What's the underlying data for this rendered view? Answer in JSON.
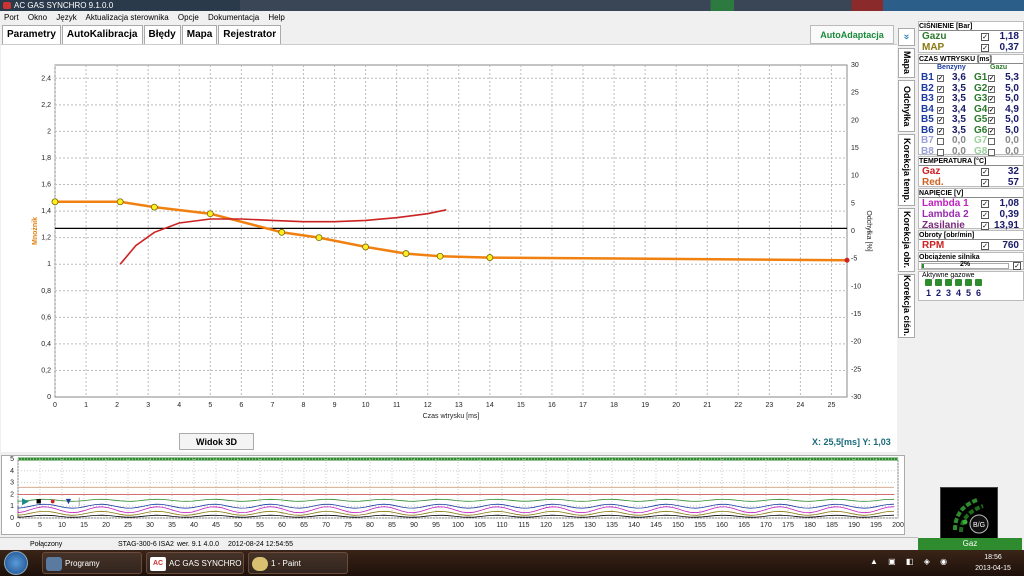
{
  "window": {
    "title": "AC GAS SYNCHRO 9.1.0.0"
  },
  "menu": [
    "Port",
    "Okno",
    "Język",
    "Aktualizacja sterownika",
    "Opcje",
    "Dokumentacja",
    "Help"
  ],
  "tabs": [
    "Parametry",
    "AutoKalibracja",
    "Błędy",
    "Mapa",
    "Rejestrator"
  ],
  "autoadapt_label": "AutoAdaptacja",
  "vertical_tabs": [
    "Mapa",
    "Odchyłka",
    "Korekcja temp.",
    "Korekcja obr.",
    "Korekcja ciśn."
  ],
  "vtab_icon": "scroll-icon",
  "right": {
    "pressure": {
      "title": "CIŚNIENIE [Bar]",
      "gaz_label": "Gazu",
      "gaz_value": "1,18",
      "map_label": "MAP",
      "map_value": "0,37"
    },
    "injection": {
      "title": "CZAS WTRYSKU [ms]",
      "benz_header": "Benzyny",
      "gaz_header": "Gazu",
      "rows": [
        {
          "b": "B1",
          "bv": "3,6",
          "g": "G1",
          "gv": "5,3"
        },
        {
          "b": "B2",
          "bv": "3,5",
          "g": "G2",
          "gv": "5,0"
        },
        {
          "b": "B3",
          "bv": "3,5",
          "g": "G3",
          "gv": "5,0"
        },
        {
          "b": "B4",
          "bv": "3,4",
          "g": "G4",
          "gv": "4,9"
        },
        {
          "b": "B5",
          "bv": "3,5",
          "g": "G5",
          "gv": "5,0"
        },
        {
          "b": "B6",
          "bv": "3,5",
          "g": "G6",
          "gv": "5,0"
        },
        {
          "b": "B7",
          "bv": "0,0",
          "g": "G7",
          "gv": "0,0"
        },
        {
          "b": "B8",
          "bv": "0,0",
          "g": "G8",
          "gv": "0,0"
        }
      ]
    },
    "temperature": {
      "title": "TEMPERATURA [°C]",
      "gaz_label": "Gaz",
      "gaz_value": "32",
      "red_label": "Red.",
      "red_value": "57"
    },
    "voltage": {
      "title": "NAPIĘCIE [V]",
      "l1_label": "Lambda 1",
      "l1_value": "1,08",
      "l2_label": "Lambda 2",
      "l2_value": "0,39",
      "zas_label": "Zasilanie",
      "zas_value": "13,91"
    },
    "rpm": {
      "title": "Obroty [obr/min]",
      "label": "RPM",
      "value": "760"
    },
    "load": {
      "title": "Obciążenie silnika",
      "value": "2%",
      "fraction": 0.02
    },
    "active": {
      "title": "Aktywne gazowe",
      "items": [
        "1",
        "2",
        "3",
        "4",
        "5",
        "6"
      ]
    }
  },
  "widok_label": "Widok 3D",
  "coords": {
    "x_label": "X:",
    "x_value": "25,5[ms]",
    "y_label": "Y:",
    "y_value": "1,03"
  },
  "gas_panel_label": "B/G",
  "gas_mode": "Gaz",
  "status": {
    "connection": "Połączony",
    "device": "STAG-300-6 ISA2",
    "version": "wer. 9.1 4.0.0",
    "date": "2012-08-24 12:54:55"
  },
  "taskbar": {
    "programs": "Programy",
    "app1": "AC GAS SYNCHRO",
    "app2": "1 - Paint",
    "time": "18:56",
    "date": "2013-04-15"
  },
  "colors": {
    "orange": "#f08010",
    "red": "#cc2222",
    "green": "#1a8a3a",
    "gaz": "#2a7a2a",
    "map": "#8a7a10",
    "lambda": "#c020c0",
    "zasilanie": "#7a2a7a",
    "temp_red": "#d06020"
  },
  "chart_data": {
    "type": "line",
    "xlabel": "Czas wtrysku [ms]",
    "ylabel": "Mnożnik",
    "y2label": "Odchyłka [%]",
    "xlim": [
      0,
      25.5
    ],
    "ylim": [
      0,
      2.5
    ],
    "y2lim": [
      -30,
      30
    ],
    "xticks": [
      0,
      1,
      2,
      3,
      4,
      5,
      6,
      7,
      8,
      9,
      10,
      11,
      12,
      13,
      14,
      15,
      16,
      17,
      18,
      19,
      20,
      21,
      22,
      23,
      24,
      25
    ],
    "yticks": [
      "0",
      "0,2",
      "0,4",
      "0,6",
      "0,8",
      "1",
      "1,2",
      "1,4",
      "1,6",
      "1,8",
      "2",
      "2,2",
      "2,4"
    ],
    "y2ticks": [
      "-30",
      "-25",
      "-20",
      "-15",
      "-10",
      "-5",
      "0",
      "5",
      "10",
      "15",
      "20",
      "25",
      "30"
    ],
    "reference_line": 1.27,
    "series": [
      {
        "color": "#f08010",
        "points": [
          [
            0,
            1.47
          ],
          [
            2.1,
            1.47
          ],
          [
            3.2,
            1.43
          ],
          [
            5,
            1.38
          ],
          [
            7.3,
            1.24
          ],
          [
            8.5,
            1.2
          ],
          [
            10,
            1.13
          ],
          [
            11.3,
            1.08
          ],
          [
            12.4,
            1.06
          ],
          [
            14,
            1.05
          ],
          [
            25.5,
            1.03
          ]
        ],
        "markers": [
          [
            0,
            1.47
          ],
          [
            2.1,
            1.47
          ],
          [
            3.2,
            1.43
          ],
          [
            5,
            1.38
          ],
          [
            7.3,
            1.24
          ],
          [
            8.5,
            1.2
          ],
          [
            10,
            1.13
          ],
          [
            11.3,
            1.08
          ],
          [
            12.4,
            1.06
          ],
          [
            14,
            1.05
          ]
        ]
      },
      {
        "color": "#cc2222",
        "points": [
          [
            2.1,
            1.0
          ],
          [
            2.6,
            1.14
          ],
          [
            3.2,
            1.24
          ],
          [
            4,
            1.31
          ],
          [
            5,
            1.34
          ],
          [
            6,
            1.34
          ],
          [
            7,
            1.33
          ],
          [
            8,
            1.32
          ],
          [
            9,
            1.32
          ],
          [
            10,
            1.33
          ],
          [
            11,
            1.35
          ],
          [
            12,
            1.38
          ],
          [
            12.6,
            1.41
          ]
        ]
      }
    ]
  },
  "lower_chart": {
    "xticks": [
      "0",
      "5",
      "10",
      "15",
      "20",
      "25",
      "30",
      "35",
      "40",
      "45",
      "50",
      "55",
      "60",
      "65",
      "70",
      "75",
      "80",
      "85",
      "90",
      "95",
      "100",
      "105",
      "110",
      "115",
      "120",
      "125",
      "130",
      "135",
      "140",
      "145",
      "150",
      "155",
      "160",
      "165",
      "170",
      "175",
      "180",
      "185",
      "190",
      "195",
      "200"
    ],
    "yticks": [
      "0",
      "1",
      "2",
      "3",
      "4",
      "5"
    ]
  }
}
